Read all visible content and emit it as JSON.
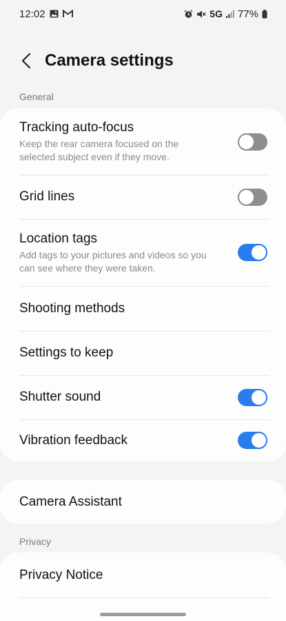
{
  "status_bar": {
    "time": "12:02",
    "network": "5G",
    "battery": "77%",
    "icons_left": [
      "image-icon",
      "gmail-icon"
    ],
    "icons_right": [
      "alarm-icon",
      "mute-icon",
      "signal-icon",
      "battery-icon"
    ]
  },
  "header": {
    "title": "Camera settings"
  },
  "sections": {
    "general": "General",
    "privacy": "Privacy"
  },
  "general_items": [
    {
      "title": "Tracking auto-focus",
      "subtitle": "Keep the rear camera focused on the selected subject even if they move.",
      "toggle": "off"
    },
    {
      "title": "Grid lines",
      "toggle": "off"
    },
    {
      "title": "Location tags",
      "subtitle": "Add tags to your pictures and videos so you can see where they were taken.",
      "toggle": "on"
    },
    {
      "title": "Shooting methods"
    },
    {
      "title": "Settings to keep"
    },
    {
      "title": "Shutter sound",
      "toggle": "on"
    },
    {
      "title": "Vibration feedback",
      "toggle": "on"
    }
  ],
  "assistant_item": {
    "title": "Camera Assistant"
  },
  "privacy_items": [
    {
      "title": "Privacy Notice"
    }
  ],
  "colors": {
    "accent": "#2a7ded",
    "toggle_off": "#8e8e8e",
    "background": "#f4f4f4",
    "card": "#fdfdfd"
  }
}
